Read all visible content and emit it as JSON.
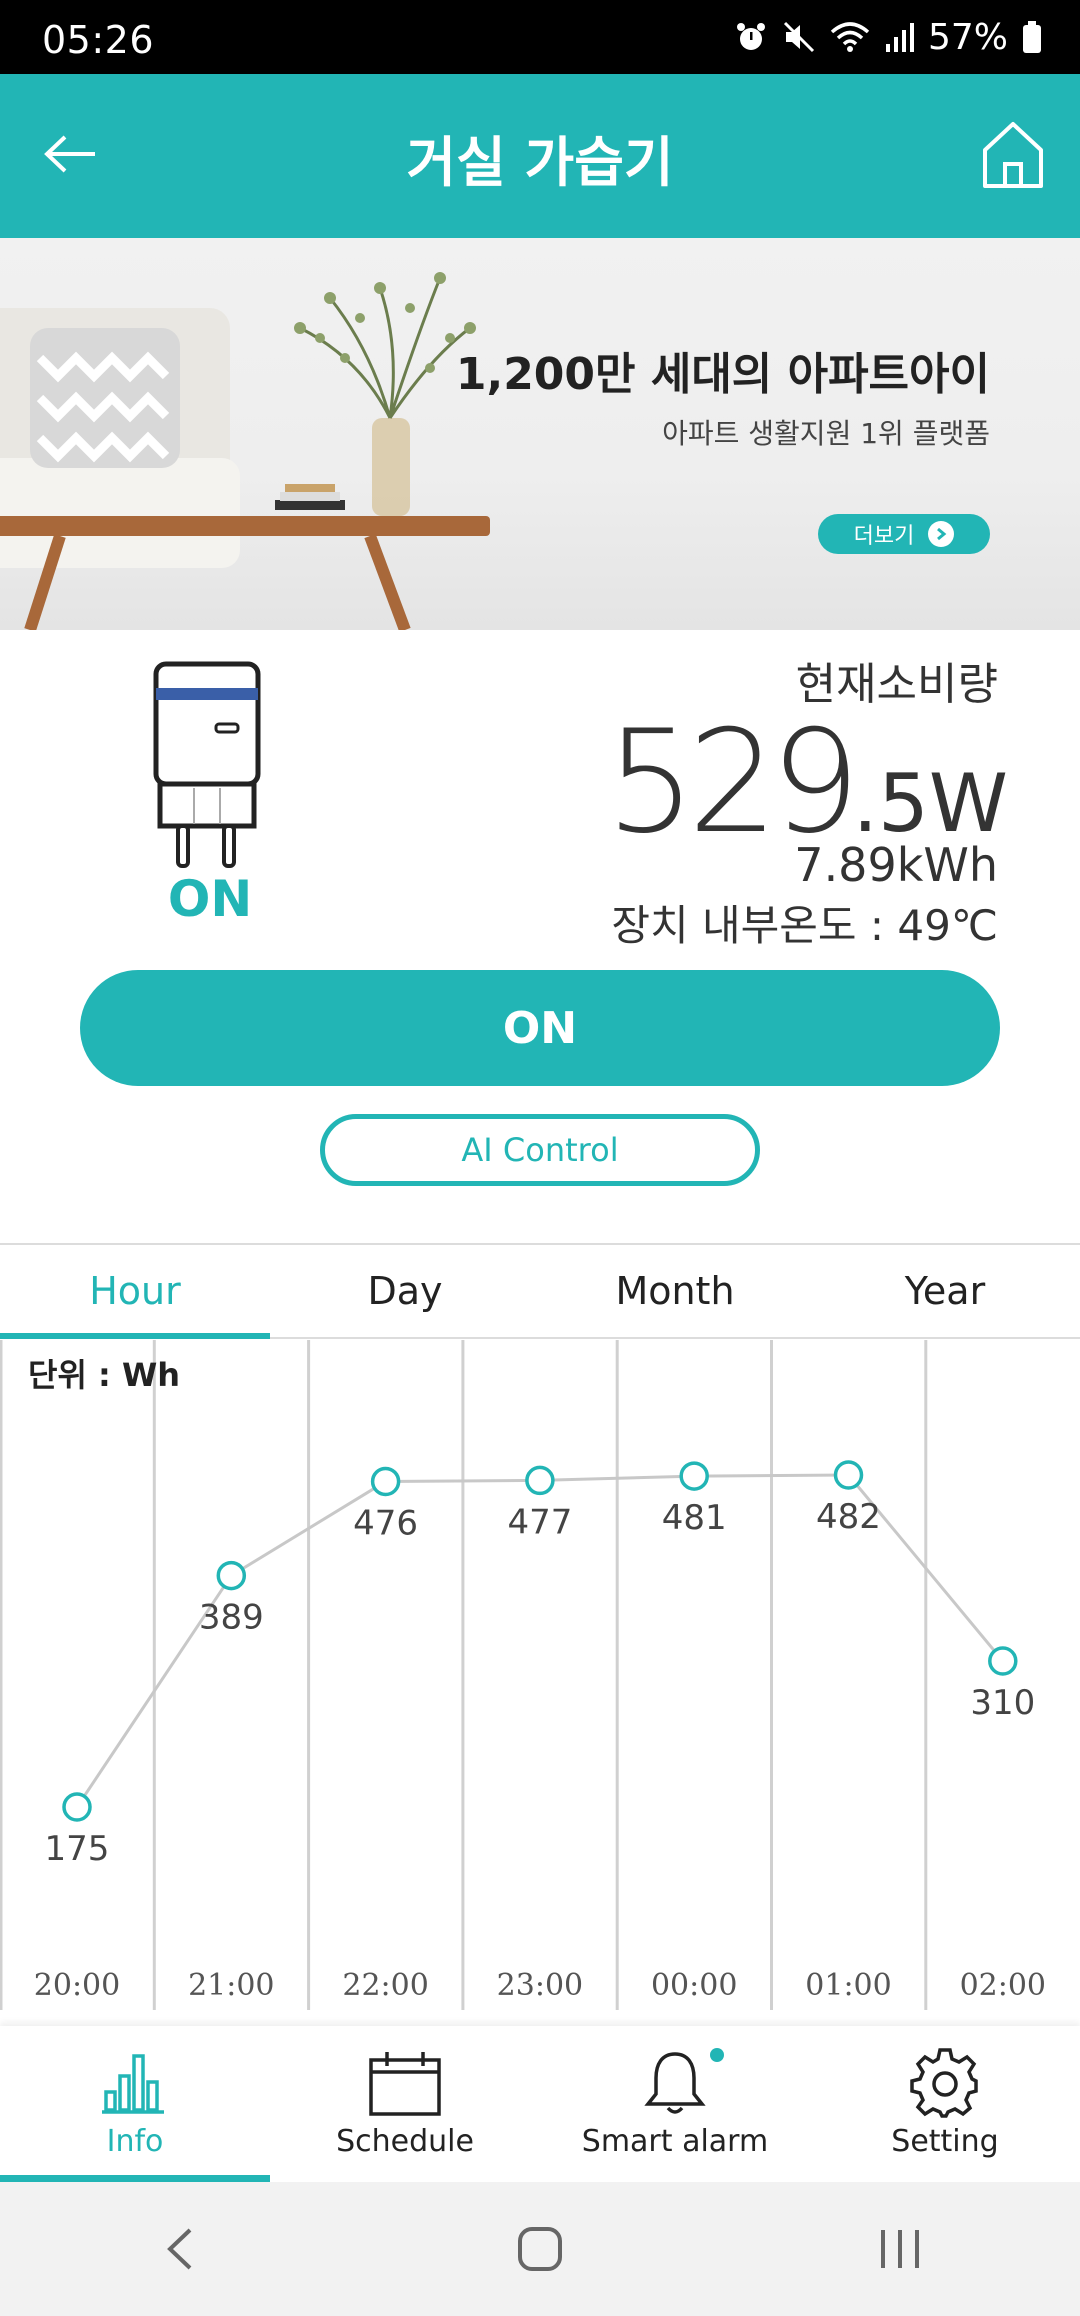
{
  "status_bar": {
    "time": "05:26",
    "battery": "57%",
    "icons": [
      "alarm-icon",
      "mute-icon",
      "wifi-icon",
      "signal-icon",
      "battery-icon"
    ]
  },
  "header": {
    "title": "거실 가습기",
    "back_icon": "arrow-left-icon",
    "home_icon": "home-icon"
  },
  "banner": {
    "title": "1,200만 세대의 아파트아이",
    "subtitle": "아파트 생활지원 1위 플랫폼",
    "more_label": "더보기"
  },
  "device": {
    "state": "ON",
    "power_label": "현재소비량",
    "power_integer": "529",
    "power_decimal": ".5W",
    "energy": "7.89kWh",
    "temperature": "장치 내부온도 : 49℃"
  },
  "controls": {
    "on_label": "ON",
    "ai_label": "AI Control"
  },
  "tabs": [
    {
      "label": "Hour",
      "active": true
    },
    {
      "label": "Day",
      "active": false
    },
    {
      "label": "Month",
      "active": false
    },
    {
      "label": "Year",
      "active": false
    }
  ],
  "chart": {
    "unit_label": "단위 : Wh"
  },
  "chart_data": {
    "type": "line",
    "categories": [
      "20:00",
      "21:00",
      "22:00",
      "23:00",
      "00:00",
      "01:00",
      "02:00"
    ],
    "values": [
      175,
      389,
      476,
      477,
      481,
      482,
      310
    ],
    "ylabel": "",
    "xlabel": "",
    "grid": true,
    "colors": {
      "line": "#c8c8c8",
      "marker": "#22b5b5",
      "grid": "#d0d0d0"
    }
  },
  "bottom_nav": [
    {
      "label": "Info",
      "icon": "bar-chart-icon",
      "active": true
    },
    {
      "label": "Schedule",
      "icon": "calendar-icon",
      "active": false
    },
    {
      "label": "Smart alarm",
      "icon": "bell-icon",
      "active": false
    },
    {
      "label": "Setting",
      "icon": "gear-icon",
      "active": false
    }
  ],
  "system_nav": [
    "back-icon",
    "home-circle-icon",
    "recents-icon"
  ],
  "colors": {
    "accent": "#22b5b5",
    "status_bar": "#000000"
  }
}
